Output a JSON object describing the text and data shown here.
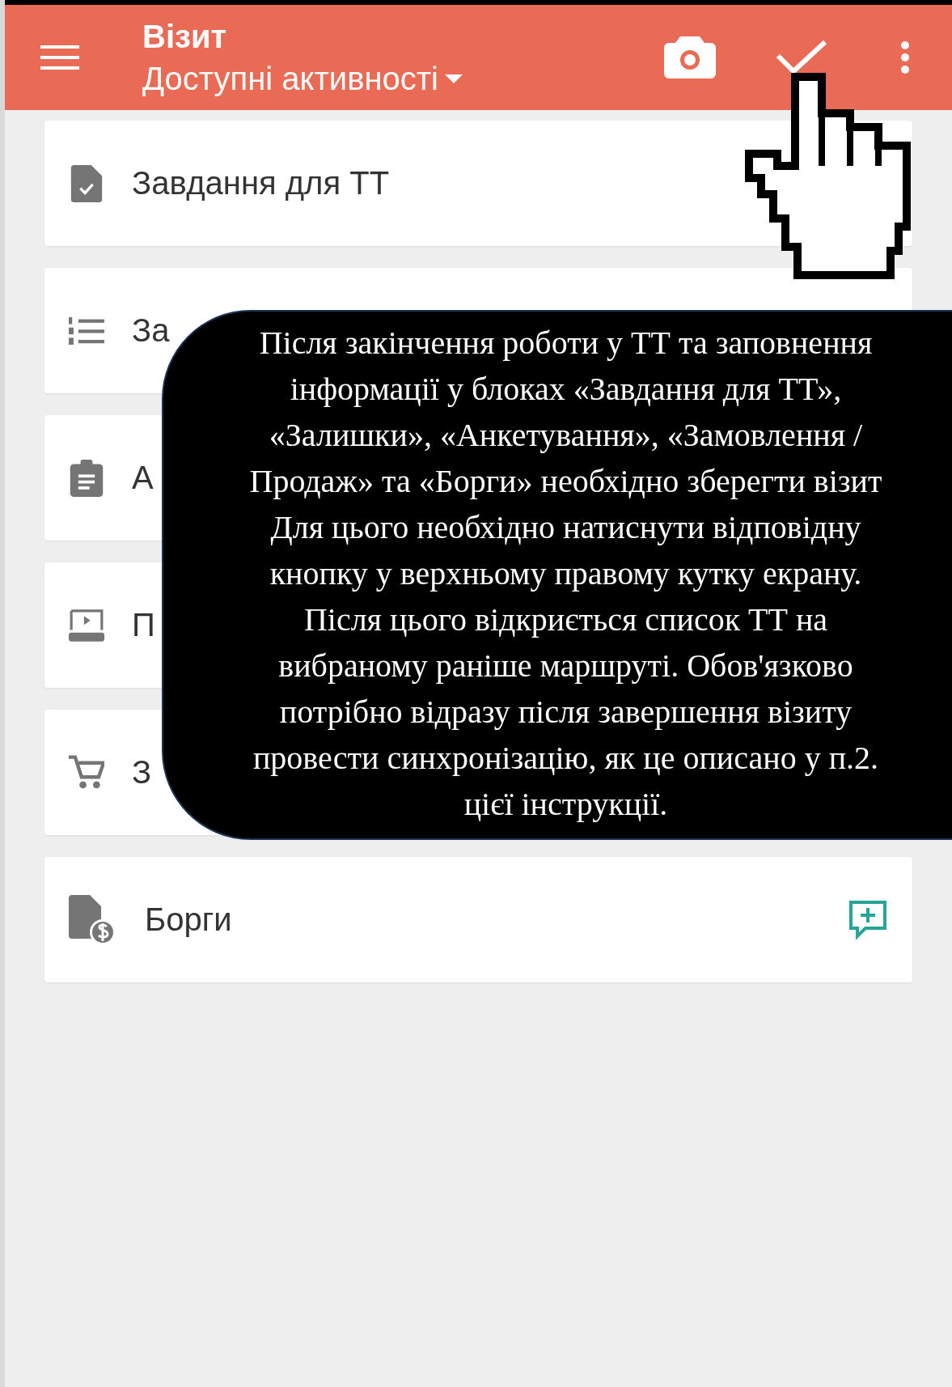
{
  "app_bar": {
    "title": "Візит",
    "subtitle": "Доступні активності"
  },
  "activities": [
    {
      "kind": "task",
      "label": "Завдання для ТТ"
    },
    {
      "kind": "list",
      "label": "За"
    },
    {
      "kind": "survey",
      "label": "А"
    },
    {
      "kind": "presentation",
      "label": "П"
    },
    {
      "kind": "order",
      "label": "З"
    },
    {
      "kind": "debts",
      "label": "Борги"
    }
  ],
  "tooltip": {
    "lines": [
      "Після закінчення роботи у ТТ та заповнення",
      "інформації у блоках «Завдання для ТТ»,",
      "«Залишки», «Анкетування», «Замовлення /",
      "Продаж» та «Борги» необхідно зберегти візит",
      "Для цього необхідно натиснути відповідну",
      "кнопку у верхньому правому кутку екрану.",
      "Після цього відкриється список ТТ на",
      "вибраному раніше маршруті. Обов'язково",
      "потрібно відразу після завершення візиту",
      "провести синхронізацію, як це описано у п.2.",
      "цієї інструкції."
    ]
  }
}
